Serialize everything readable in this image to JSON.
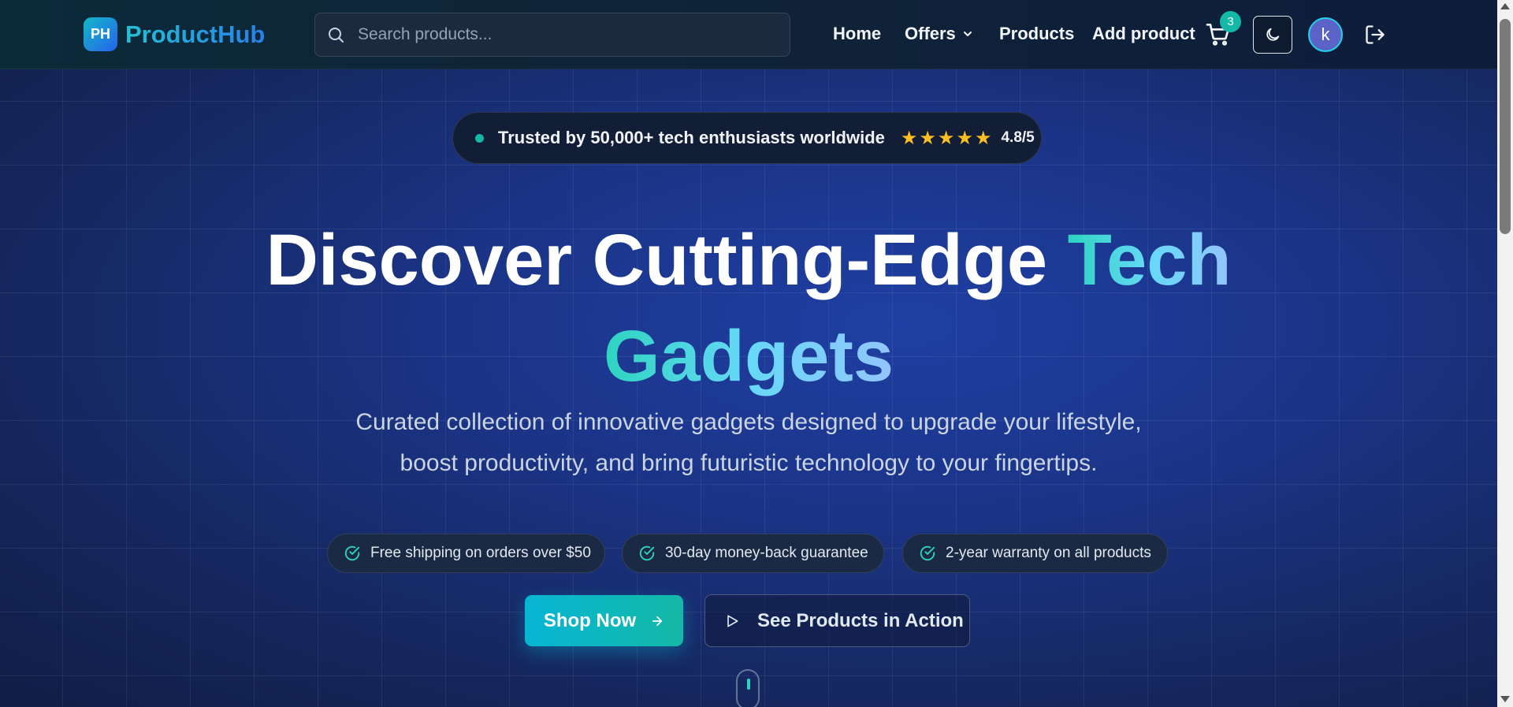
{
  "header": {
    "logo_badge": "PH",
    "logo_text": "ProductHub",
    "search_placeholder": "Search products...",
    "nav": {
      "home": "Home",
      "offers": "Offers",
      "products": "Products",
      "add_product": "Add product"
    },
    "cart_count": "3",
    "avatar_letter": "k",
    "icons": [
      "search-icon",
      "chevron-down-icon",
      "cart-icon",
      "moon-icon",
      "logout-icon"
    ]
  },
  "hero": {
    "trust_text": "Trusted by 50,000+ tech enthusiasts worldwide",
    "stars": "★★★★★",
    "rating": "4.8/5",
    "headline_part1": "Discover Cutting-Edge ",
    "headline_accent1": "Tech",
    "headline_accent2": "Gadgets",
    "subtitle_line1": "Curated collection of innovative gadgets designed to upgrade your lifestyle,",
    "subtitle_line2": "boost productivity, and bring futuristic technology to your fingertips.",
    "features": [
      "Free shipping on orders over $50",
      "30-day money-back guarantee",
      "2-year warranty on all products"
    ],
    "shop_button": "Shop Now",
    "see_button": "See Products in Action"
  },
  "colors": {
    "accent_teal": "#14b8a6",
    "accent_cyan": "#06b6d4",
    "star": "#fbbf24"
  }
}
